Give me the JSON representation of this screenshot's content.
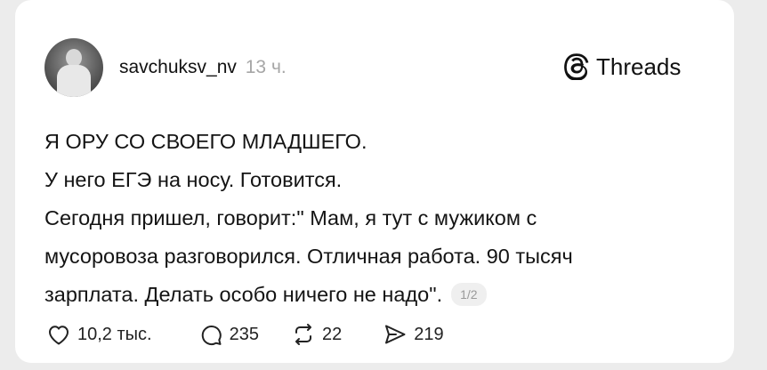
{
  "post": {
    "username": "savchuksv_nv",
    "time": "13 ч.",
    "brand": "Threads",
    "lines": [
      "Я ОРУ СО СВОЕГО МЛАДШЕГО.",
      "У него ЕГЭ на носу. Готовится.",
      "Сегодня пришел, говорит:\" Мам, я тут с мужиком с",
      "мусоровоза разговорился. Отличная работа. 90 тысяч",
      "зарплата. Делать особо ничего не надо\"."
    ],
    "page_indicator": "1/2"
  },
  "actions": {
    "likes": "10,2 тыс.",
    "replies": "235",
    "reposts": "22",
    "shares": "219"
  },
  "icons": {
    "like": "heart-icon",
    "reply": "comment-bubble-icon",
    "repost": "repost-icon",
    "share": "send-icon",
    "brand": "threads-logo-icon"
  }
}
